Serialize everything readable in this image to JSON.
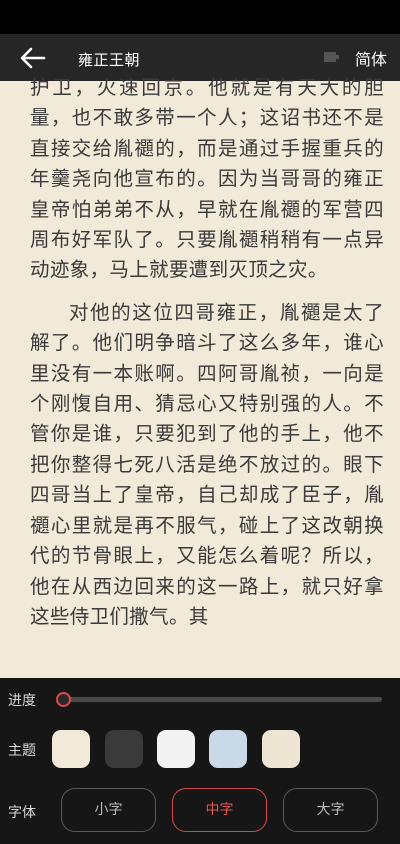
{
  "header": {
    "book_title": "雍正王朝",
    "language_toggle": "简体"
  },
  "content": {
    "paragraphs": [
      "护卫，火速回京。他就是有天大的胆量，也不敢多带一个人；这诏书还不是直接交给胤禵的，而是通过手握重兵的年羹尧向他宣布的。因为当哥哥的雍正皇帝怕弟弟不从，早就在胤禵的军营四周布好军队了。只要胤禵稍稍有一点异动迹象，马上就要遭到灭顶之灾。",
      "对他的这位四哥雍正，胤禵是太了解了。他们明争暗斗了这么多年，谁心里没有一本账啊。四阿哥胤祯，一向是个刚愎自用、猜忌心又特别强的人。不管你是谁，只要犯到了他的手上，他不把你整得七死八活是绝不放过的。眼下四哥当上了皇帝，自己却成了臣子，胤禵心里就是再不服气，碰上了这改朝换代的节骨眼上，又能怎么着呢？所以，他在从西边回来的这一路上，就只好拿这些侍卫们撒气。其"
    ]
  },
  "settings": {
    "progress_label": "进度",
    "progress_value": 0.01,
    "theme_label": "主题",
    "themes": [
      "#f2ead9",
      "#3a3a3a",
      "#f3f3f3",
      "#c9d9e8",
      "#eee5d2"
    ],
    "font_label": "字体",
    "font_sizes": [
      "小字",
      "中字",
      "大字"
    ],
    "selected_font": "中字"
  },
  "colors": {
    "accent": "#e04848",
    "page_bg": "#f2ead9",
    "panel_bg": "#161616"
  }
}
